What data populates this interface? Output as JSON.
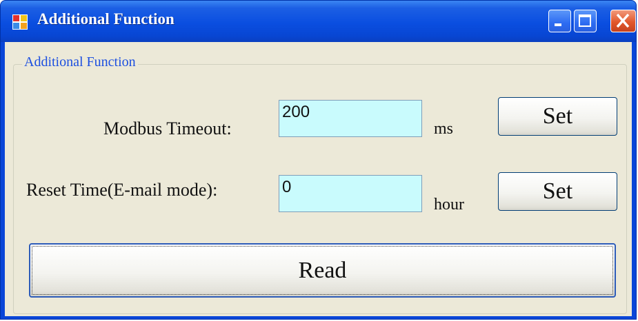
{
  "window": {
    "title": "Additional Function",
    "app_icon": "window-app-icon",
    "controls": [
      "minimize-icon",
      "maximize-icon",
      "close-icon"
    ]
  },
  "group": {
    "title": "Additional Function"
  },
  "modbus_timeout": {
    "label": "Modbus Timeout:",
    "value": "200",
    "unit": "ms",
    "button_label": "Set"
  },
  "reset_time": {
    "label": "Reset Time(E-mail mode):",
    "value": "0",
    "unit": "hour",
    "button_label": "Set"
  },
  "read_button": {
    "label": "Read"
  },
  "colors": {
    "titlebar": "#0a4ee0",
    "input_bg": "#c9fbfd",
    "client_bg": "#ece9d8",
    "group_title": "#1c4fe0"
  }
}
